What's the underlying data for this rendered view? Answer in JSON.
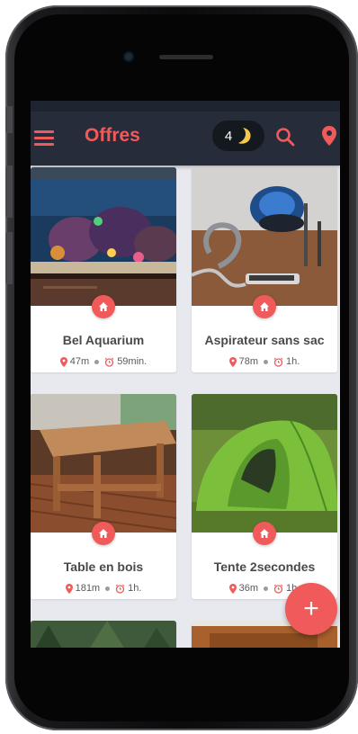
{
  "app": {
    "title": "Offres",
    "nights_count": "4"
  },
  "offers": [
    {
      "name": "Bel Aquarium",
      "distance": "47m",
      "time": "59min."
    },
    {
      "name": "Aspirateur sans sac",
      "distance": "78m",
      "time": "1h."
    },
    {
      "name": "Table en bois",
      "distance": "181m",
      "time": "1h."
    },
    {
      "name": "Tente 2secondes",
      "distance": "36m",
      "time": "1h."
    }
  ],
  "fab": {
    "label": "+"
  },
  "icons": {
    "menu": "hamburger-menu-icon",
    "moon": "moon-icon",
    "search": "search-icon",
    "location": "location-pin-icon",
    "badge": "home-icon",
    "time": "alarm-clock-icon"
  },
  "colors": {
    "accent": "#f05a5b",
    "appbar": "#262c3a",
    "moon": "#f6c94a",
    "background": "#e8e9ee"
  }
}
